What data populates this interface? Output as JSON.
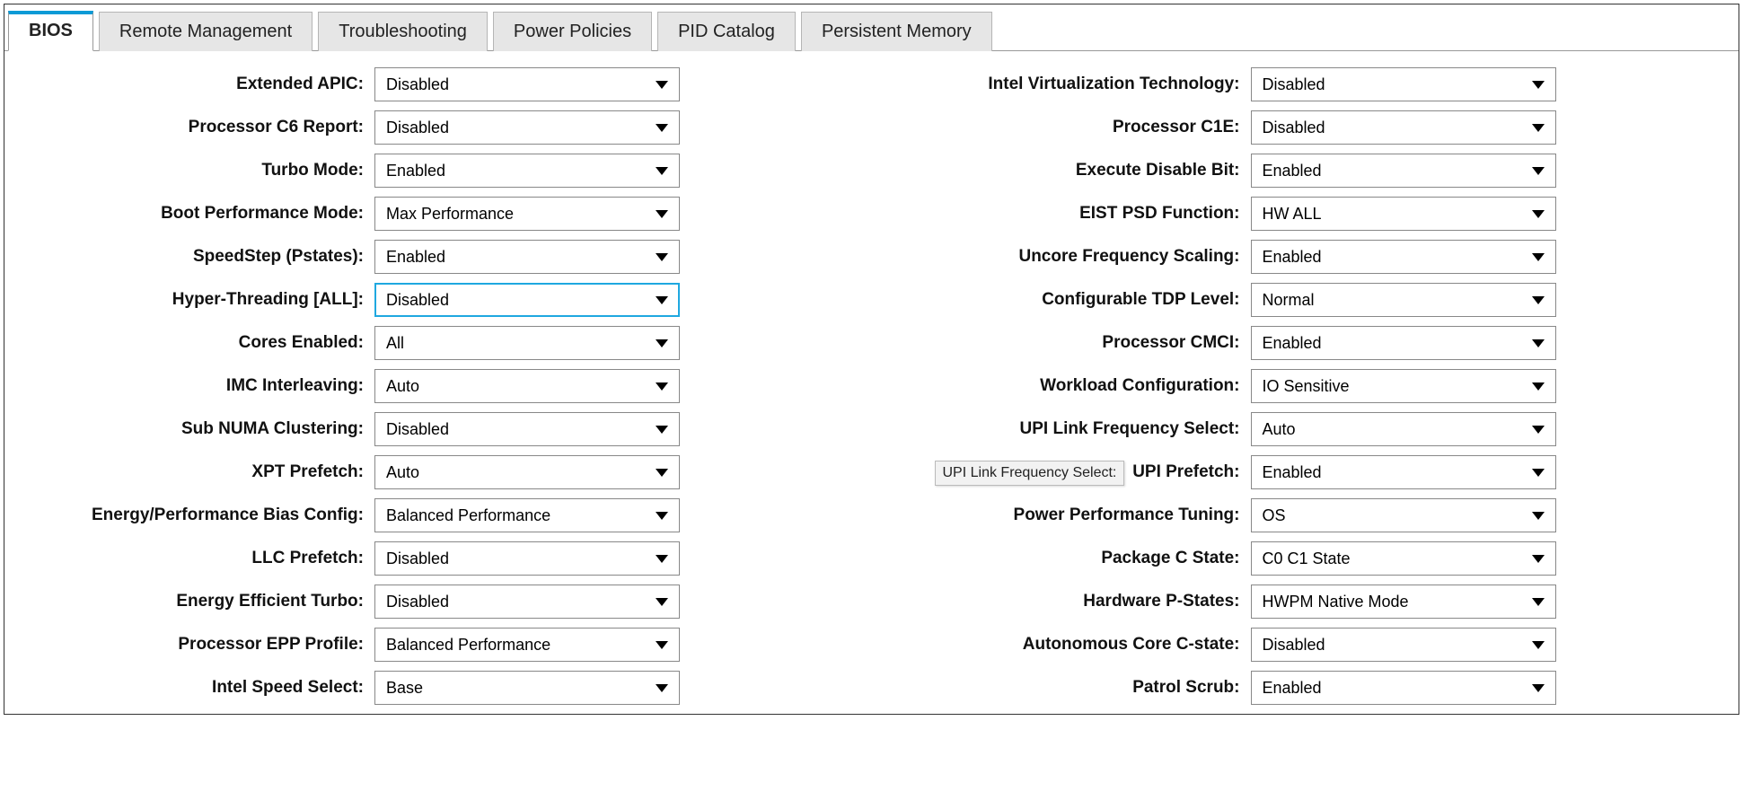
{
  "tabs": {
    "active": "BIOS",
    "items": [
      "BIOS",
      "Remote Management",
      "Troubleshooting",
      "Power Policies",
      "PID Catalog",
      "Persistent Memory"
    ]
  },
  "left": [
    {
      "label": "Extended APIC:",
      "value": "Disabled",
      "name": "extended-apic"
    },
    {
      "label": "Processor C6 Report:",
      "value": "Disabled",
      "name": "processor-c6-report"
    },
    {
      "label": "Turbo Mode:",
      "value": "Enabled",
      "name": "turbo-mode"
    },
    {
      "label": "Boot Performance Mode:",
      "value": "Max Performance",
      "name": "boot-performance-mode"
    },
    {
      "label": "SpeedStep (Pstates):",
      "value": "Enabled",
      "name": "speedstep-pstates"
    },
    {
      "label": "Hyper-Threading [ALL]:",
      "value": "Disabled",
      "name": "hyper-threading",
      "focused": true
    },
    {
      "label": "Cores Enabled:",
      "value": "All",
      "name": "cores-enabled"
    },
    {
      "label": "IMC Interleaving:",
      "value": "Auto",
      "name": "imc-interleaving"
    },
    {
      "label": "Sub NUMA Clustering:",
      "value": "Disabled",
      "name": "sub-numa-clustering"
    },
    {
      "label": "XPT Prefetch:",
      "value": "Auto",
      "name": "xpt-prefetch"
    },
    {
      "label": "Energy/Performance Bias Config:",
      "value": "Balanced Performance",
      "name": "energy-performance-bias-config"
    },
    {
      "label": "LLC Prefetch:",
      "value": "Disabled",
      "name": "llc-prefetch"
    },
    {
      "label": "Energy Efficient Turbo:",
      "value": "Disabled",
      "name": "energy-efficient-turbo"
    },
    {
      "label": "Processor EPP Profile:",
      "value": "Balanced Performance",
      "name": "processor-epp-profile"
    },
    {
      "label": "Intel Speed Select:",
      "value": "Base",
      "name": "intel-speed-select"
    }
  ],
  "right": [
    {
      "label": "Intel Virtualization Technology:",
      "value": "Disabled",
      "name": "intel-virtualization-technology"
    },
    {
      "label": "Processor C1E:",
      "value": "Disabled",
      "name": "processor-c1e"
    },
    {
      "label": "Execute Disable Bit:",
      "value": "Enabled",
      "name": "execute-disable-bit"
    },
    {
      "label": "EIST PSD Function:",
      "value": "HW ALL",
      "name": "eist-psd-function"
    },
    {
      "label": "Uncore Frequency Scaling:",
      "value": "Enabled",
      "name": "uncore-frequency-scaling"
    },
    {
      "label": "Configurable TDP Level:",
      "value": "Normal",
      "name": "configurable-tdp-level"
    },
    {
      "label": "Processor CMCI:",
      "value": "Enabled",
      "name": "processor-cmci"
    },
    {
      "label": "Workload Configuration:",
      "value": "IO Sensitive",
      "name": "workload-configuration"
    },
    {
      "label": "UPI Link Frequency Select:",
      "value": "Auto",
      "name": "upi-link-frequency-select"
    },
    {
      "label": "UPI Prefetch:",
      "value": "Enabled",
      "name": "upi-prefetch",
      "tooltip": "UPI Link Frequency Select:"
    },
    {
      "label": "Power Performance Tuning:",
      "value": "OS",
      "name": "power-performance-tuning"
    },
    {
      "label": "Package C State:",
      "value": "C0 C1 State",
      "name": "package-c-state"
    },
    {
      "label": "Hardware P-States:",
      "value": "HWPM Native Mode",
      "name": "hardware-p-states"
    },
    {
      "label": "Autonomous Core C-state:",
      "value": "Disabled",
      "name": "autonomous-core-c-state"
    },
    {
      "label": "Patrol Scrub:",
      "value": "Enabled",
      "name": "patrol-scrub"
    }
  ]
}
